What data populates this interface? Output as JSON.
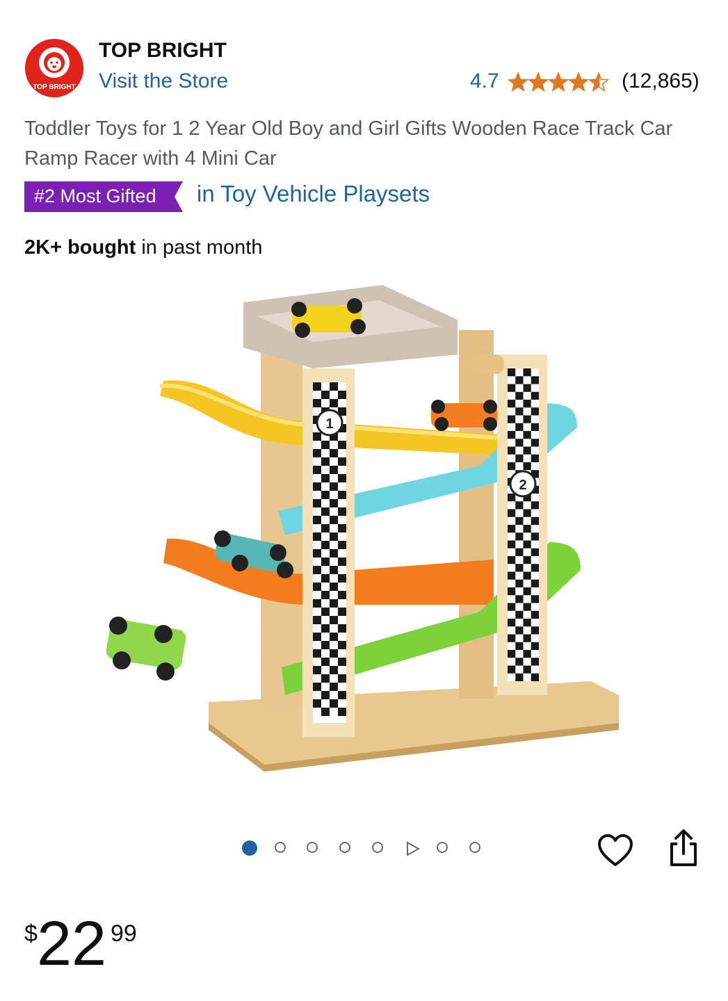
{
  "header": {
    "brand_name": "TOP BRIGHT",
    "visit_store_label": "Visit the Store",
    "logo_text": "TOP BRIGHT",
    "rating_value": "4.7",
    "rating_stars": 4.7,
    "rating_count": "(12,865)"
  },
  "product": {
    "title": "Toddler Toys for 1 2 Year Old Boy and Girl Gifts Wooden Race Track Car Ramp Racer with 4 Mini Car",
    "badge_label": "#2 Most Gifted",
    "badge_category": "in Toy Vehicle Playsets",
    "bought_bold": "2K+ bought",
    "bought_rest": " in past month",
    "image_icon": "wooden-race-track-image",
    "car_number_1": "1",
    "car_number_2": "2"
  },
  "carousel": {
    "slide_count": 8,
    "active_index": 0,
    "video_index": 5
  },
  "actions": {
    "wishlist_icon": "heart-icon",
    "share_icon": "share-icon"
  },
  "price": {
    "currency_symbol": "$",
    "whole": "22",
    "fraction": "99"
  },
  "colors": {
    "link": "#2162a1",
    "badge": "#7b20b3",
    "star": "#de7921",
    "logo_red": "#e0231b"
  }
}
